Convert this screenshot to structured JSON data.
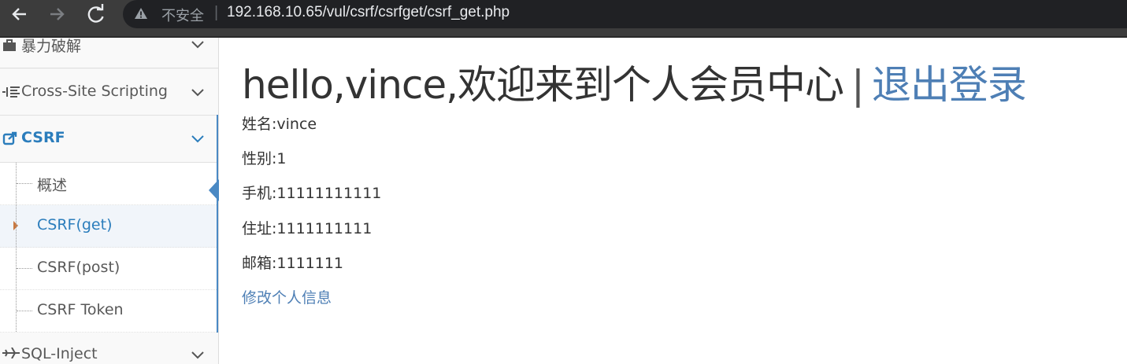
{
  "browser": {
    "security_label": "不安全",
    "url": "192.168.10.65/vul/csrf/csrfget/csrf_get.php"
  },
  "sidebar": {
    "groups": [
      {
        "label": "暴力破解",
        "icon": "briefcase-icon"
      },
      {
        "label": "Cross-Site Scripting",
        "icon": "list-icon"
      },
      {
        "label": "CSRF",
        "icon": "share-icon"
      },
      {
        "label": "SQL-Inject",
        "icon": "plane-icon"
      }
    ],
    "csrf_items": [
      {
        "label": "概述"
      },
      {
        "label": "CSRF(get)"
      },
      {
        "label": "CSRF(post)"
      },
      {
        "label": "CSRF Token"
      }
    ]
  },
  "main": {
    "greeting": "hello,vince,欢迎来到个人会员中心",
    "separator": "|",
    "logout": "退出登录",
    "fields": [
      {
        "text": "姓名:vince"
      },
      {
        "text": "性别:1"
      },
      {
        "text": "手机:11111111111"
      },
      {
        "text": "住址:1111111111"
      },
      {
        "text": "邮箱:1111111"
      }
    ],
    "edit_link": "修改个人信息"
  },
  "colors": {
    "link": "#4e7fb5",
    "active": "#2b7dbc",
    "toolbar": "#3c3c3c"
  }
}
